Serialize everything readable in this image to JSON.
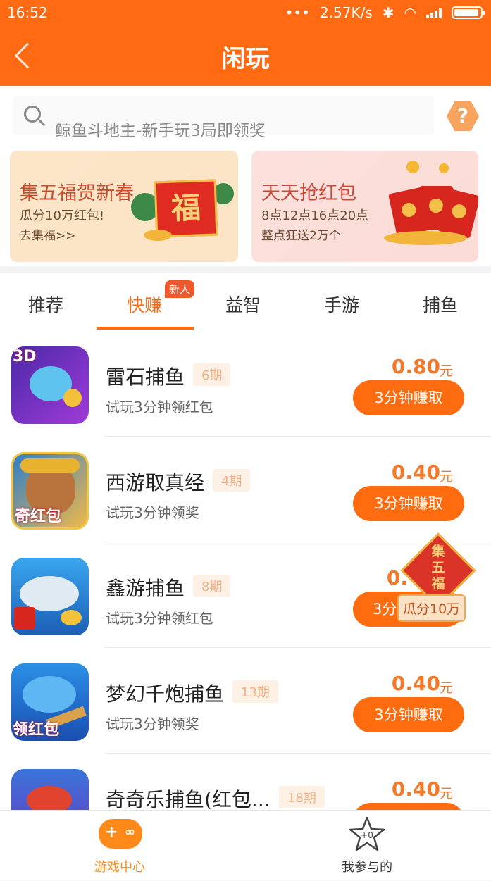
{
  "status_bar": {
    "time": "16:52",
    "dots": "•••",
    "net_speed": "2.57K/s",
    "bluetooth": "✱",
    "wifi": "◠"
  },
  "nav": {
    "title": "闲玩",
    "back_icon": "chevron-left-icon"
  },
  "search": {
    "placeholder": "鲸鱼斗地主-新手玩3局即领奖",
    "help": "?"
  },
  "banners": [
    {
      "title": "集五福贺新春",
      "subtitle": "瓜分10万红包!",
      "link": "去集福>>",
      "card_char": "福"
    },
    {
      "title": "天天抢红包",
      "subtitle": "8点12点16点20点",
      "link": "整点狂送2万个"
    }
  ],
  "tabs": [
    {
      "label": "推荐",
      "active": false
    },
    {
      "label": "快赚",
      "active": true,
      "badge": "新人"
    },
    {
      "label": "益智",
      "active": false
    },
    {
      "label": "手游",
      "active": false
    },
    {
      "label": "捕鱼",
      "active": false
    }
  ],
  "games": [
    {
      "name": "雷石捕鱼",
      "period": "6期",
      "desc": "试玩3分钟领红包",
      "price": "0.80",
      "unit": "元",
      "action": "3分钟赚取",
      "icon_tag": "3D"
    },
    {
      "name": "西游取真经",
      "period": "4期",
      "desc": "试玩3分钟领奖",
      "price": "0.40",
      "unit": "元",
      "action": "3分钟赚取",
      "icon_tag": "奇红包"
    },
    {
      "name": "鑫游捕鱼",
      "period": "8期",
      "desc": "试玩3分钟领红包",
      "price": "0.",
      "unit": "",
      "action": "3分",
      "icon_tag": ""
    },
    {
      "name": "梦幻千炮捕鱼",
      "period": "13期",
      "desc": "试玩3分钟领奖",
      "price": "0.40",
      "unit": "元",
      "action": "3分钟赚取",
      "icon_tag": "领红包"
    },
    {
      "name": "奇奇乐捕鱼(红包...",
      "period": "18期",
      "desc": "",
      "price": "0.40",
      "unit": "元",
      "action": "",
      "icon_tag": ""
    }
  ],
  "promo": {
    "diamond_text": "集五福",
    "label": "瓜分10万"
  },
  "bottom_nav": [
    {
      "label": "游戏中心",
      "icon": "gamepad-icon",
      "active": true
    },
    {
      "label": "我参与的",
      "icon": "star-icon",
      "active": false
    }
  ],
  "colors": {
    "accent": "#ff6a12",
    "price": "#f27a2a",
    "button": "#ff6c10"
  }
}
